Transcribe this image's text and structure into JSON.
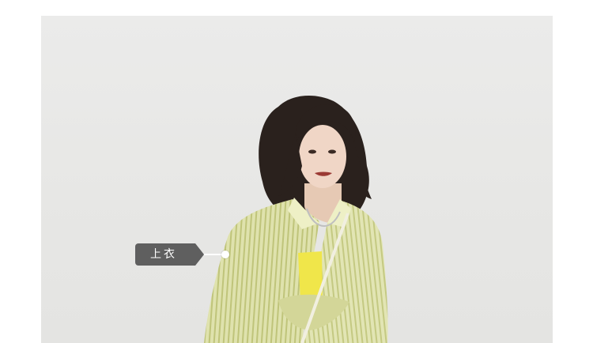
{
  "tag": {
    "label": "上衣"
  },
  "colors": {
    "background": "#ffffff",
    "photo_backdrop": "#e8e8e6",
    "tag_fill": "#5f5f5f",
    "tag_text": "#ffffff",
    "shirt": "#d9dca0",
    "camisole": "#f0e64a",
    "hair": "#2a211d"
  },
  "icons": {
    "pointer": "hotspot-dot-icon"
  }
}
